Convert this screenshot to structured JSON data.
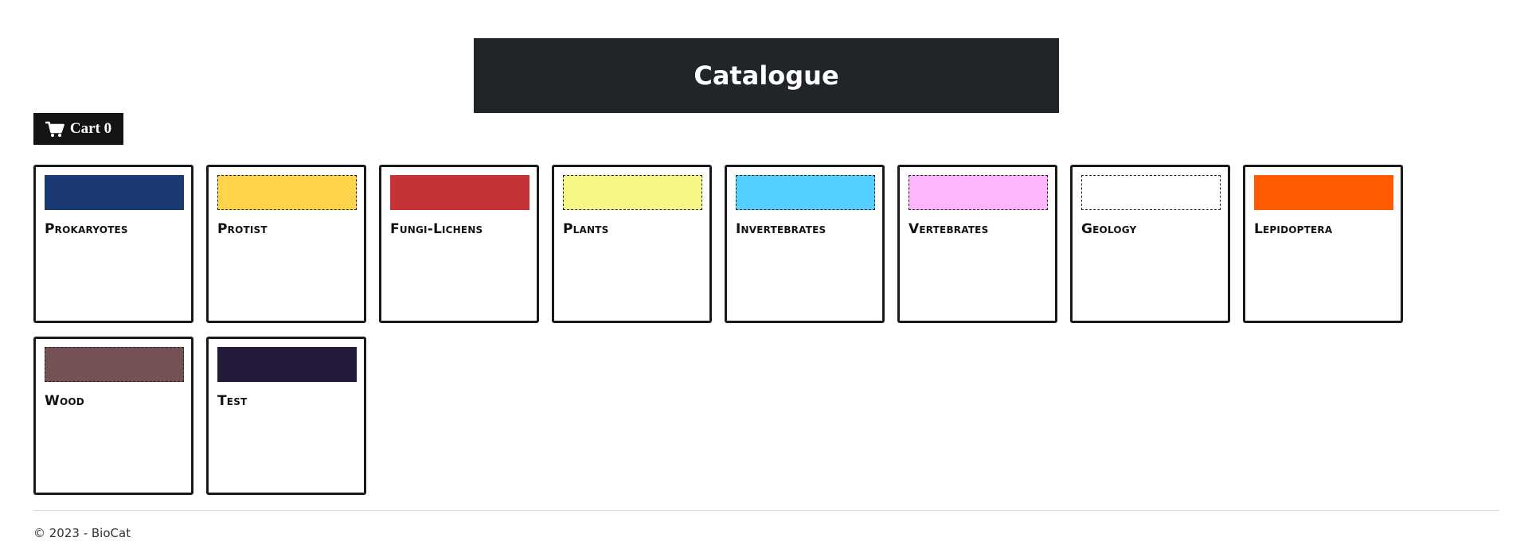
{
  "header": {
    "title": "Catalogue"
  },
  "cart": {
    "label": "Cart",
    "count": "0",
    "icon": "shopping-cart-icon"
  },
  "categories": [
    {
      "label": "Prokaryotes",
      "color": "#1c3a72"
    },
    {
      "label": "Protist",
      "color": "#ffd44a"
    },
    {
      "label": "Fungi-Lichens",
      "color": "#c63337"
    },
    {
      "label": "Plants",
      "color": "#f6f784"
    },
    {
      "label": "Invertebrates",
      "color": "#55cffd"
    },
    {
      "label": "Vertebrates",
      "color": "#fdb6fd"
    },
    {
      "label": "Geology",
      "color": "#ffffff"
    },
    {
      "label": "Lepidoptera",
      "color": "#fe5a01"
    },
    {
      "label": "Wood",
      "color": "#735155"
    },
    {
      "label": "Test",
      "color": "#221a38"
    }
  ],
  "footer": {
    "text": "© 2023 - BioCat"
  }
}
